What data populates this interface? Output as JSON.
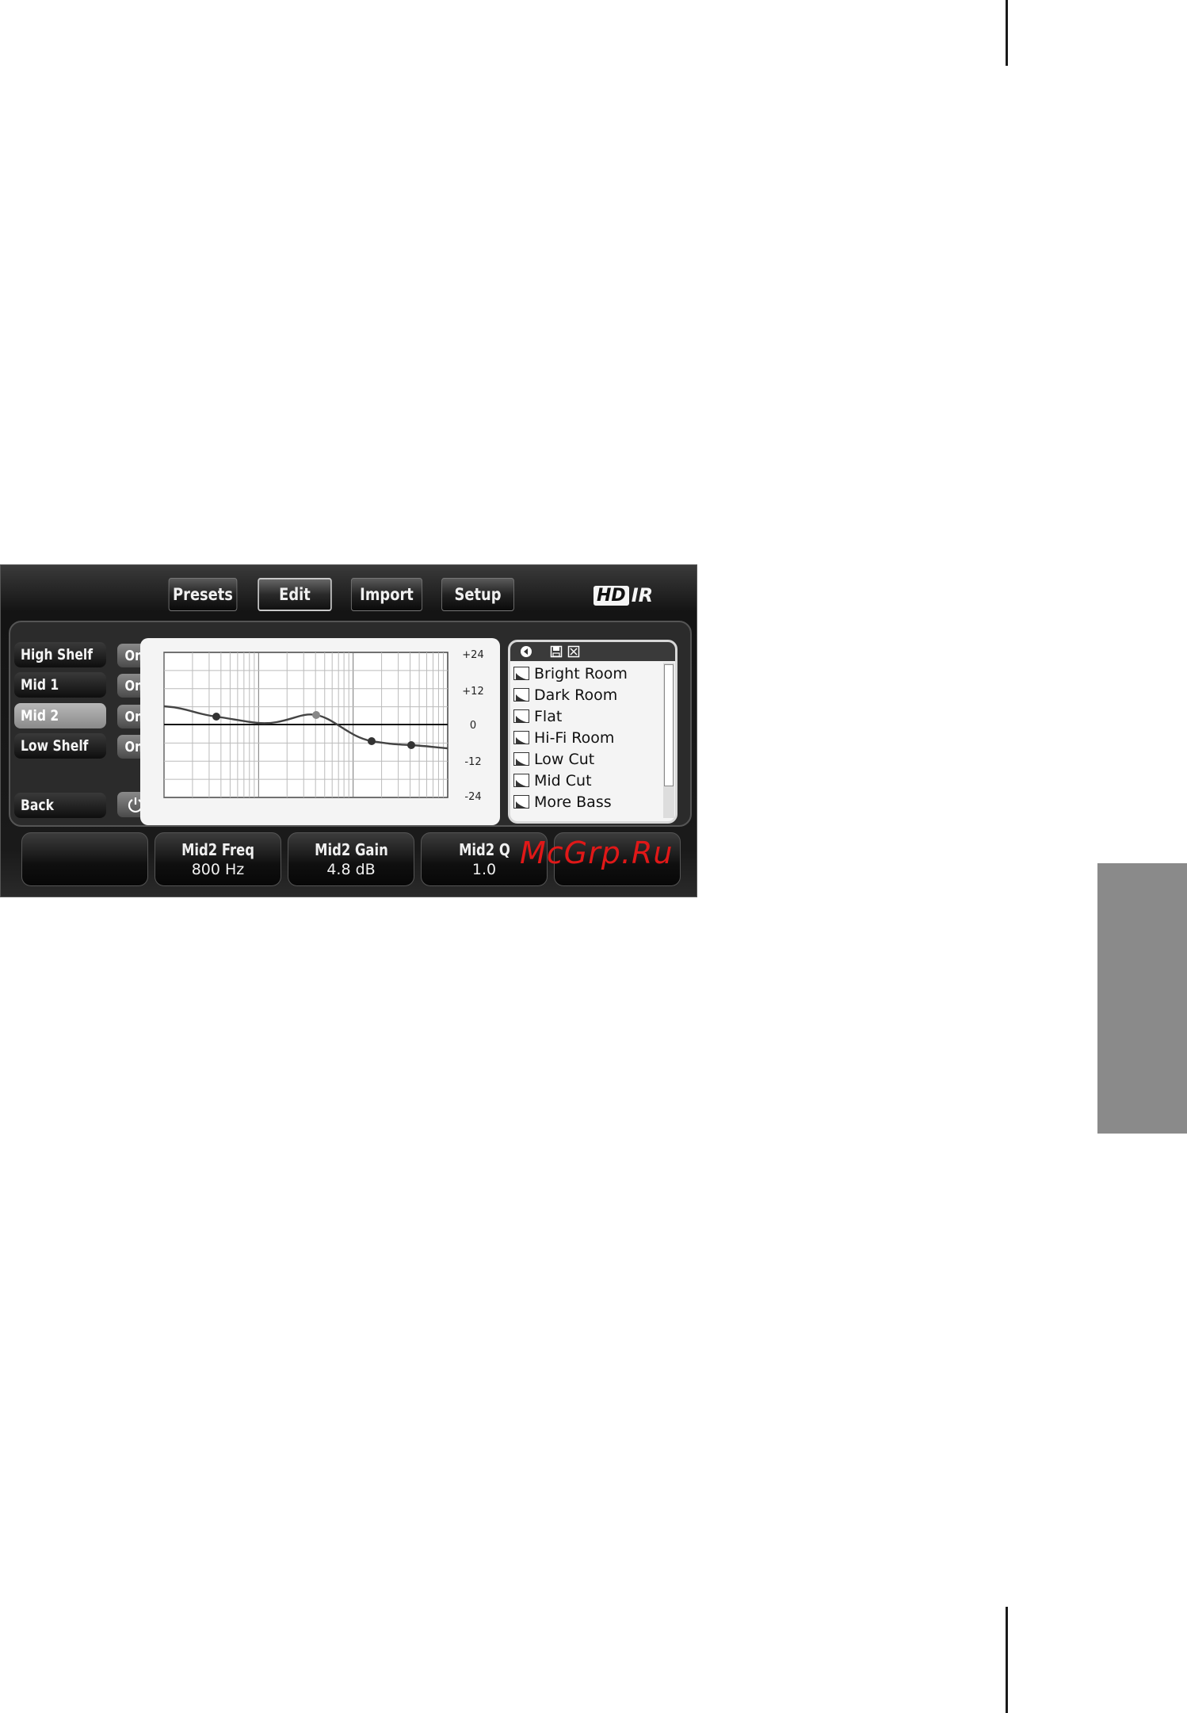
{
  "toolbar": {
    "tabs": [
      {
        "label": "Presets"
      },
      {
        "label": "Edit"
      },
      {
        "label": "Import"
      },
      {
        "label": "Setup"
      }
    ],
    "logo": {
      "hd": "HD",
      "ir": "IR"
    }
  },
  "bands": [
    {
      "label": "High Shelf",
      "state": "On"
    },
    {
      "label": "Mid 1",
      "state": "On"
    },
    {
      "label": "Mid 2",
      "state": "On"
    },
    {
      "label": "Low Shelf",
      "state": "On"
    }
  ],
  "back_label": "Back",
  "graph": {
    "db_labels": [
      "+24",
      "+12",
      "0",
      "-12",
      "-24"
    ]
  },
  "presets": {
    "items": [
      "Bright Room",
      "Dark Room",
      "Flat",
      "Hi-Fi Room",
      "Low Cut",
      "Mid Cut",
      "More Bass"
    ]
  },
  "params": [
    {
      "name": "",
      "value": ""
    },
    {
      "name": "Mid2 Freq",
      "value": "800 Hz"
    },
    {
      "name": "Mid2 Gain",
      "value": "4.8 dB"
    },
    {
      "name": "Mid2 Q",
      "value": "1.0"
    }
  ],
  "watermark": "McGrp.Ru",
  "colors": {
    "selected_band": "#9a9a9a",
    "watermark": "#e01818"
  }
}
